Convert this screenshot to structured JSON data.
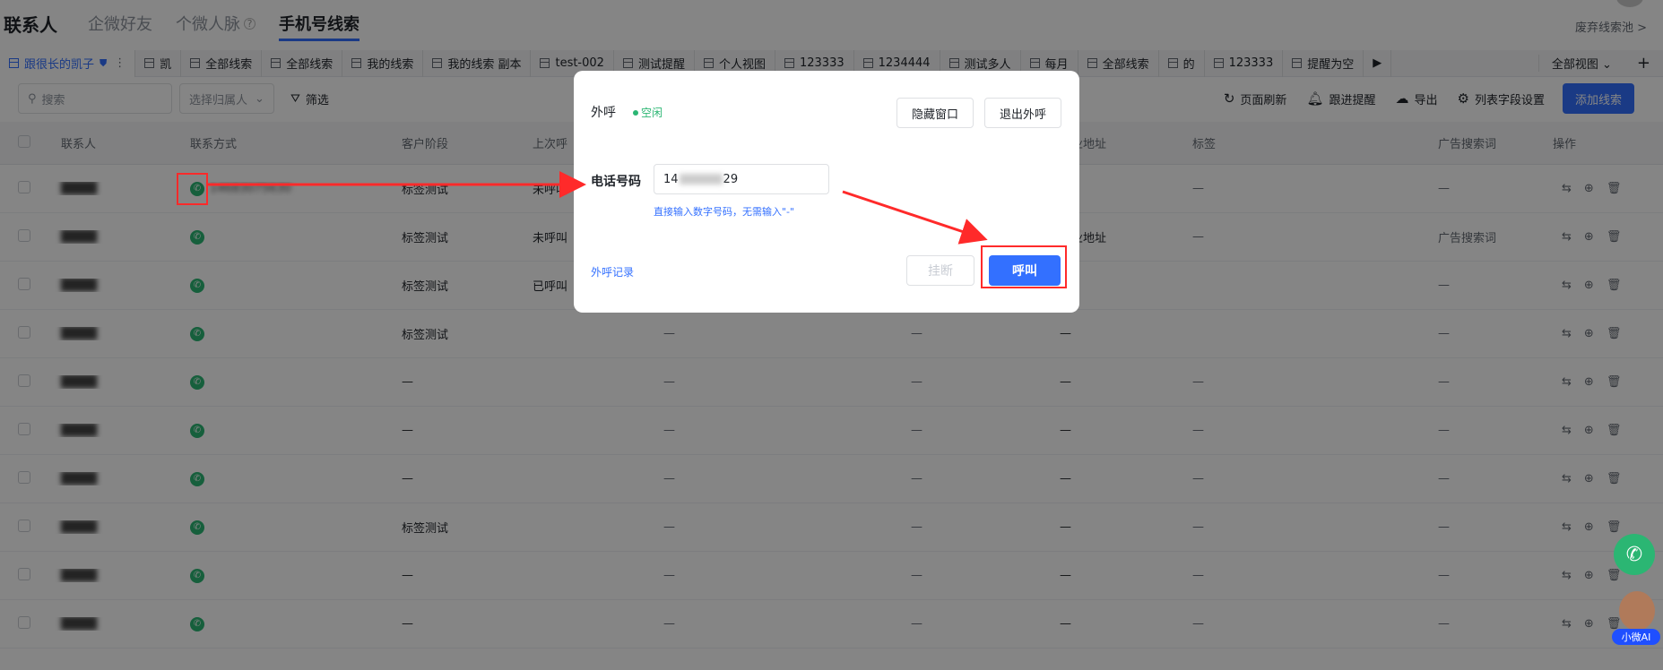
{
  "header": {
    "title": "联系人",
    "tabs": [
      {
        "label": "企微好友"
      },
      {
        "label": "个微人脉"
      },
      {
        "label": "手机号线索"
      }
    ],
    "right_link": "废弃线索池 >"
  },
  "view_tabs": [
    {
      "label": "跟很长的凯子"
    },
    {
      "label": "凯"
    },
    {
      "label": "全部线索"
    },
    {
      "label": "全部线索"
    },
    {
      "label": "我的线索"
    },
    {
      "label": "我的线索 副本"
    },
    {
      "label": "test-002"
    },
    {
      "label": "测试提醒"
    },
    {
      "label": "个人视图"
    },
    {
      "label": "123333"
    },
    {
      "label": "1234444"
    },
    {
      "label": "测试多人"
    },
    {
      "label": "每月"
    },
    {
      "label": "全部线索"
    },
    {
      "label": "的"
    },
    {
      "label": "123333"
    },
    {
      "label": "提醒为空"
    }
  ],
  "view_tabs_right": {
    "all_views": "全部视图",
    "add": "+"
  },
  "toolbar": {
    "search_placeholder": "搜索",
    "owner_placeholder": "选择归属人",
    "filter": "筛选",
    "refresh": "页面刷新",
    "followup": "跟进提醒",
    "export": "导出",
    "column_settings": "列表字段设置",
    "add_lead": "添加线索"
  },
  "table": {
    "columns": [
      "联系人",
      "联系方式",
      "客户阶段",
      "上次呼",
      "",
      "",
      "企业地址",
      "标签",
      "广告搜索词",
      "操作"
    ],
    "rows": [
      {
        "phone": "14683075630",
        "stage": "标签测试",
        "last": "未呼叫",
        "a": "",
        "b": "",
        "addr": "",
        "tag": "—",
        "ad": "—"
      },
      {
        "phone": "",
        "stage": "标签测试",
        "last": "未呼叫",
        "a": "",
        "b": "",
        "addr": "企业地址",
        "tag": "—",
        "ad": "广告搜索词"
      },
      {
        "phone": "",
        "stage": "标签测试",
        "last": "已呼叫",
        "a": "",
        "b": "",
        "addr": "",
        "tag": "",
        "ad": "—"
      },
      {
        "phone": "",
        "stage": "标签测试",
        "last": "",
        "a": "—",
        "b": "—",
        "addr": "—",
        "tag": "",
        "ad": "—"
      },
      {
        "phone": "",
        "stage": "—",
        "last": "",
        "a": "—",
        "b": "—",
        "addr": "—",
        "tag": "—",
        "ad": "—"
      },
      {
        "phone": "",
        "stage": "—",
        "last": "",
        "a": "—",
        "b": "—",
        "addr": "—",
        "tag": "—",
        "ad": "—"
      },
      {
        "phone": "",
        "stage": "—",
        "last": "",
        "a": "—",
        "b": "—",
        "addr": "—",
        "tag": "—",
        "ad": "—"
      },
      {
        "phone": "",
        "stage": "标签测试",
        "last": "",
        "a": "—",
        "b": "—",
        "addr": "—",
        "tag": "—",
        "ad": "—"
      },
      {
        "phone": "",
        "stage": "—",
        "last": "",
        "a": "—",
        "b": "—",
        "addr": "—",
        "tag": "—",
        "ad": "—"
      },
      {
        "phone": "",
        "stage": "—",
        "last": "",
        "a": "—",
        "b": "—",
        "addr": "—",
        "tag": "—",
        "ad": "—"
      }
    ]
  },
  "dialog": {
    "title": "外呼",
    "status": "空闲",
    "hide_button": "隐藏窗口",
    "exit_button": "退出外呼",
    "phone_label": "电话号码",
    "phone_prefix": "14",
    "phone_suffix": "29",
    "hint": "直接输入数字号码，无需输入\"-\"",
    "record_link": "外呼记录",
    "hangup_button": "挂断",
    "call_button": "呼叫"
  },
  "ai_assistant": {
    "label": "小微AI"
  },
  "colors": {
    "accent": "#3370ff",
    "success": "#2bb673",
    "annotation": "#ff2a2a"
  }
}
